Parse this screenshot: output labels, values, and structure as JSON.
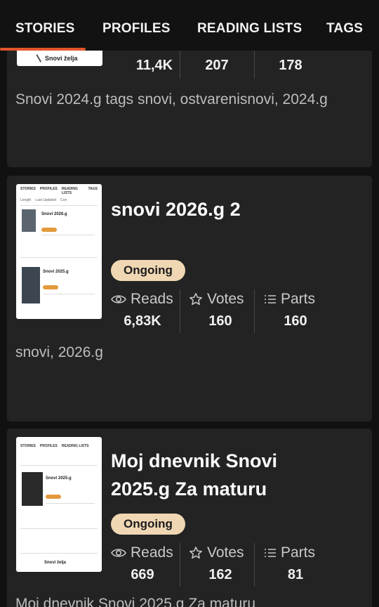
{
  "tabs": [
    {
      "label": "STORIES",
      "active": true
    },
    {
      "label": "PROFILES",
      "active": false
    },
    {
      "label": "READING LISTS",
      "active": false
    },
    {
      "label": "TAGS",
      "active": false
    }
  ],
  "colors": {
    "accent": "#e0562a",
    "badge_bg": "#f0d7b4",
    "card_bg": "#232323"
  },
  "stories": [
    {
      "title": "",
      "cover_caption": "Snovi želja",
      "reads": "11,4K",
      "votes": "207",
      "parts": "178",
      "description": "Snovi 2024.g tags snovi, ostvarenisnovi, 2024.g"
    },
    {
      "title": "snovi 2026.g 2",
      "status": "Ongoing",
      "reads_label": "Reads",
      "votes_label": "Votes",
      "parts_label": "Parts",
      "reads": "6,83K",
      "votes": "160",
      "parts": "160",
      "description": "snovi, 2026.g",
      "cover": {
        "tabs": [
          "STORIES",
          "PROFILES",
          "READING LISTS",
          "TAGS"
        ],
        "filters": [
          "Length",
          "Last Updated",
          "Con"
        ],
        "t1": "Snovi 2026.g",
        "t2": "Snovi 2025.g"
      }
    },
    {
      "title_line1": "Moj dnevnik Snovi",
      "title_line2": "2025.g Za maturu",
      "status": "Ongoing",
      "reads_label": "Reads",
      "votes_label": "Votes",
      "parts_label": "Parts",
      "reads": "669",
      "votes": "162",
      "parts": "81",
      "description": "Moj dnevnik Snovi 2025.g Za maturu",
      "cover": {
        "tabs": [
          "STORIES",
          "PROFILES",
          "READING LISTS"
        ],
        "t1": "Snovi 2025.g",
        "caption": "Snovi želja"
      }
    }
  ]
}
